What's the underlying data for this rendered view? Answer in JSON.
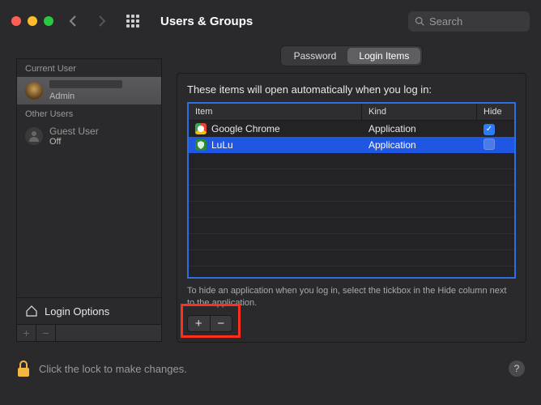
{
  "window": {
    "title": "Users & Groups",
    "search_placeholder": "Search"
  },
  "sidebar": {
    "sections": [
      {
        "label": "Current User"
      },
      {
        "label": "Other Users"
      }
    ],
    "current_user": {
      "name_redacted": true,
      "role": "Admin"
    },
    "guest_user": {
      "name": "Guest User",
      "status": "Off"
    },
    "login_options_label": "Login Options"
  },
  "tabs": {
    "password": "Password",
    "login_items": "Login Items",
    "active": "login_items"
  },
  "panel": {
    "intro": "These items will open automatically when you log in:",
    "columns": {
      "item": "Item",
      "kind": "Kind",
      "hide": "Hide"
    },
    "items": [
      {
        "icon": "chrome",
        "name": "Google Chrome",
        "kind": "Application",
        "hide": true,
        "selected": false
      },
      {
        "icon": "lulu",
        "name": "LuLu",
        "kind": "Application",
        "hide": false,
        "selected": true
      }
    ],
    "hint": "To hide an application when you log in, select the tickbox in the Hide column next to the application."
  },
  "footer": {
    "lock_text": "Click the lock to make changes."
  },
  "help_glyph": "?"
}
